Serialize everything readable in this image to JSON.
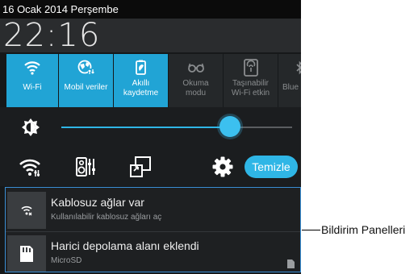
{
  "status_bar": {
    "date": "16 Ocak 2014 Perşembe"
  },
  "clock": {
    "time": "22:16"
  },
  "quick_settings": [
    {
      "label": "Wi-Fi",
      "state": "on",
      "icon": "wifi-icon"
    },
    {
      "label": "Mobil veriler",
      "state": "on",
      "icon": "mobile-data-globe-icon"
    },
    {
      "label_line1": "Akıllı",
      "label_line2": "kaydetme",
      "state": "on",
      "icon": "smart-save-icon"
    },
    {
      "label_line1": "Okuma",
      "label_line2": "modu",
      "state": "off",
      "icon": "reading-glasses-icon"
    },
    {
      "label_line1": "Taşınabilir",
      "label_line2": "Wi-Fi etkin",
      "state": "off",
      "icon": "portable-hotspot-icon"
    },
    {
      "label": "Blue",
      "state": "off",
      "icon": "bluetooth-icon"
    }
  ],
  "brightness": {
    "level": 0.73,
    "icon": "brightness-icon"
  },
  "tools": [
    {
      "icon": "wifi-settings-icon"
    },
    {
      "icon": "audio-profile-icon"
    },
    {
      "icon": "screen-mirror-icon"
    },
    {
      "icon": "settings-gear-icon"
    }
  ],
  "clear_button": {
    "label": "Temizle"
  },
  "notifications": [
    {
      "title": "Kablosuz ağlar var",
      "subtitle": "Kullanılabilir kablosuz ağları aç",
      "icon": "wifi-available-icon"
    },
    {
      "title": "Harici depolama alanı eklendi",
      "subtitle": "MicroSD",
      "icon": "sd-card-icon"
    }
  ],
  "callout": {
    "label": "Bildirim Panelleri"
  },
  "colors": {
    "accent": "#21a4d5",
    "slider": "#3cc0ef",
    "panel": "#161819",
    "frame": "#3a8fd6"
  }
}
